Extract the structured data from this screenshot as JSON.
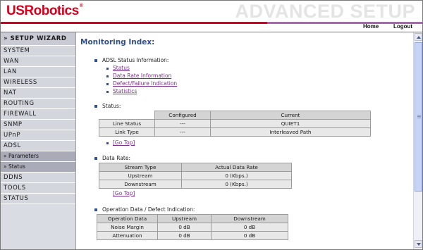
{
  "header": {
    "brand": "USRobotics",
    "brand_mark": "®",
    "section_title": "ADVANCED SETUP",
    "nav": {
      "home": "Home",
      "logout": "Logout"
    },
    "colors": {
      "brand_red": "#d6001c",
      "accent_purple": "#b060b8"
    }
  },
  "sidebar": {
    "wizard": "» SETUP WIZARD",
    "items": [
      "SYSTEM",
      "WAN",
      "LAN",
      "WIRELESS",
      "NAT",
      "ROUTING",
      "FIREWALL",
      "SNMP",
      "UPnP",
      "ADSL"
    ],
    "sub_items": [
      "» Parameters",
      "» Status"
    ],
    "items_after": [
      "DDNS",
      "TOOLS",
      "STATUS"
    ]
  },
  "main": {
    "title": "Monitoring Index:",
    "index_heading": "ADSL Status Information:",
    "index_links": [
      "Status",
      "Data Rate Information",
      "Defect/Failure Indication",
      "Statistics"
    ],
    "go_top": "[Go Top]",
    "status": {
      "heading": "Status:",
      "headers": [
        "Configured",
        "Current"
      ],
      "rows": [
        {
          "label": "Line Status",
          "configured": "---",
          "current": "QUIET1"
        },
        {
          "label": "Link Type",
          "configured": "---",
          "current": "Interleaved Path"
        }
      ]
    },
    "data_rate": {
      "heading": "Data Rate:",
      "headers": [
        "Stream Type",
        "Actual Data Rate"
      ],
      "rows": [
        {
          "label": "Upstream",
          "value": "0 (Kbps.)"
        },
        {
          "label": "Downstream",
          "value": "0 (Kbps.)"
        }
      ]
    },
    "operation": {
      "heading": "Operation Data / Defect Indication:",
      "headers": [
        "Operation Data",
        "Upstream",
        "Downstream"
      ],
      "rows": [
        {
          "label": "Noise Margin",
          "up": "0 dB",
          "down": "0 dB"
        },
        {
          "label": "Attenuation",
          "up": "0 dB",
          "down": "0 dB"
        }
      ]
    }
  }
}
